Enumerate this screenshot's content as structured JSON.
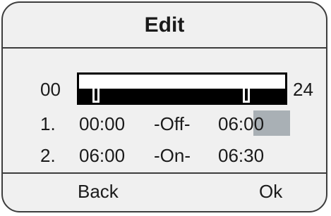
{
  "screen": {
    "title": "Edit"
  },
  "timeline": {
    "start_label": "00",
    "end_label": "24",
    "markers_hours": [
      2,
      19.5
    ]
  },
  "entries": [
    {
      "index": "1.",
      "from": "00:00",
      "state": "-Off-",
      "to": "06:00",
      "editing_field": "to",
      "editing_part": "minutes"
    },
    {
      "index": "2.",
      "from": "06:00",
      "state": "-On-",
      "to": "06:30"
    }
  ],
  "softkeys": {
    "back": "Back",
    "ok": "Ok"
  },
  "colors": {
    "frame": "#3d3d3d",
    "screen_bg": "#f0f0f0",
    "cursor": "#a9b0b5"
  }
}
